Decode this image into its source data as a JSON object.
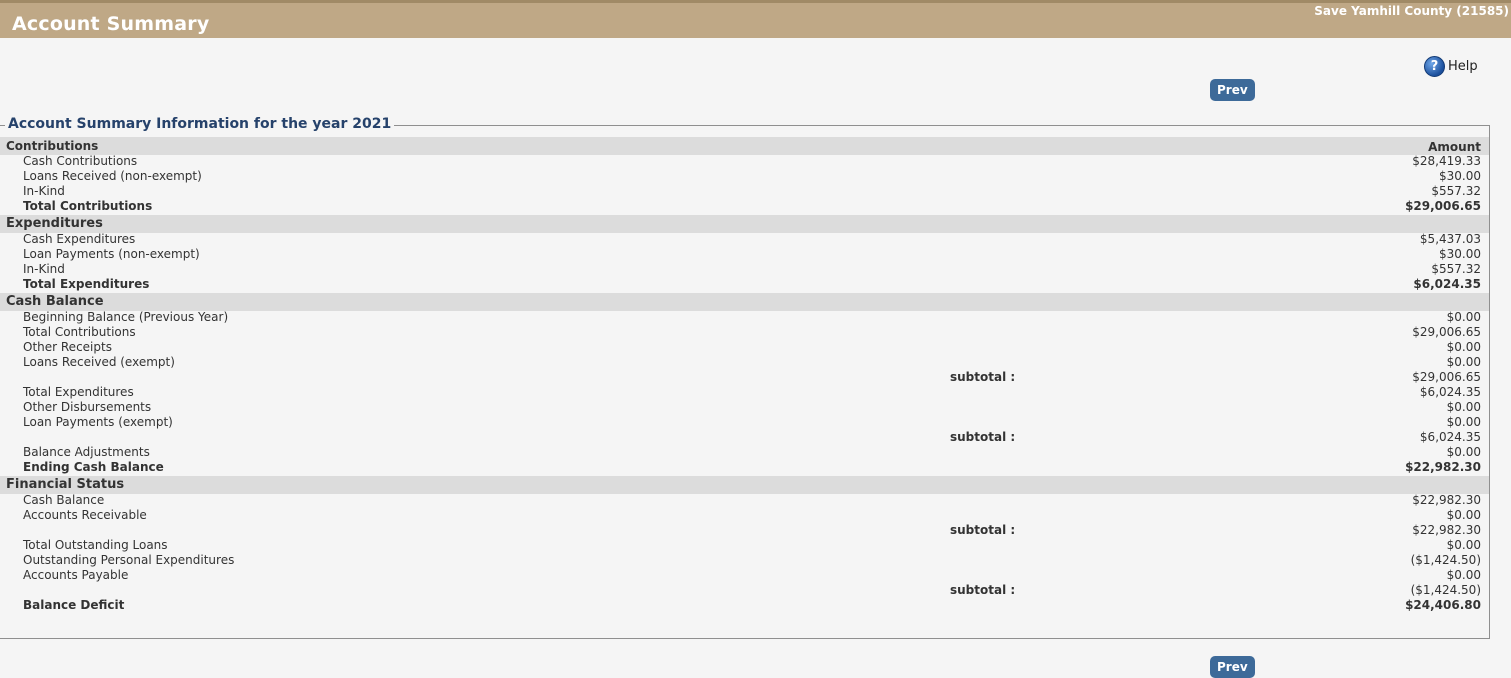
{
  "header": {
    "title": "Account Summary",
    "org": "Save Yamhill County (21585)"
  },
  "help_label": "Help",
  "prev_label": "Prev",
  "section_title": "Account Summary Information for the year 2021",
  "contributions": {
    "title": "Contributions",
    "amount_header": "Amount",
    "rows": [
      {
        "label": "Cash Contributions",
        "amount": "$28,419.33"
      },
      {
        "label": "Loans Received (non-exempt)",
        "amount": "$30.00"
      },
      {
        "label": "In-Kind",
        "amount": "$557.32"
      },
      {
        "label": "Total Contributions",
        "amount": "$29,006.65"
      }
    ]
  },
  "expenditures": {
    "title": "Expenditures",
    "rows": [
      {
        "label": "Cash Expenditures",
        "amount": "$5,437.03"
      },
      {
        "label": "Loan Payments (non-exempt)",
        "amount": "$30.00"
      },
      {
        "label": "In-Kind",
        "amount": "$557.32"
      },
      {
        "label": "Total Expenditures",
        "amount": "$6,024.35"
      }
    ]
  },
  "cash_balance": {
    "title": "Cash Balance",
    "rows": [
      {
        "label": "Beginning Balance (Previous Year)",
        "amount": "$0.00"
      },
      {
        "label": "Total Contributions",
        "amount": "$29,006.65"
      },
      {
        "label": "Other Receipts",
        "amount": "$0.00"
      },
      {
        "label": "Loans Received (exempt)",
        "amount": "$0.00"
      },
      {
        "label": "subtotal :",
        "amount": "$29,006.65"
      },
      {
        "label": "Total Expenditures",
        "amount": "$6,024.35"
      },
      {
        "label": "Other Disbursements",
        "amount": "$0.00"
      },
      {
        "label": "Loan Payments (exempt)",
        "amount": "$0.00"
      },
      {
        "label": "subtotal :",
        "amount": "$6,024.35"
      },
      {
        "label": "Balance Adjustments",
        "amount": "$0.00"
      },
      {
        "label": "Ending Cash Balance",
        "amount": "$22,982.30"
      }
    ]
  },
  "financial_status": {
    "title": "Financial Status",
    "rows": [
      {
        "label": "Cash Balance",
        "amount": "$22,982.30"
      },
      {
        "label": "Accounts Receivable",
        "amount": "$0.00"
      },
      {
        "label": "subtotal :",
        "amount": "$22,982.30"
      },
      {
        "label": "Total Outstanding Loans",
        "amount": "$0.00"
      },
      {
        "label": "Outstanding Personal Expenditures",
        "amount": "($1,424.50)"
      },
      {
        "label": "Accounts Payable",
        "amount": "$0.00"
      },
      {
        "label": "subtotal :",
        "amount": "($1,424.50)"
      },
      {
        "label": "Balance Deficit",
        "amount": "$24,406.80"
      }
    ]
  }
}
